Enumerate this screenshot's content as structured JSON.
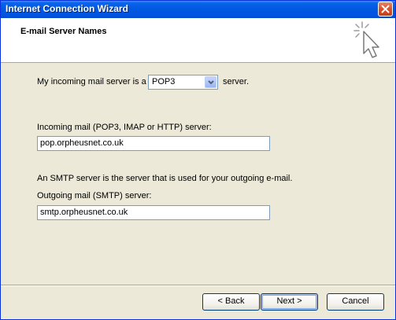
{
  "window": {
    "title": "Internet Connection Wizard"
  },
  "header": {
    "title": "E-mail Server Names"
  },
  "form": {
    "incoming_type_prefix": "My incoming mail server is a",
    "incoming_type_value": "POP3",
    "incoming_type_suffix": "server.",
    "incoming_label": "Incoming mail (POP3, IMAP or HTTP) server:",
    "incoming_value": "pop.orpheusnet.co.uk",
    "smtp_info": "An SMTP server is the server that is used for your outgoing e-mail.",
    "outgoing_label": "Outgoing mail (SMTP) server:",
    "outgoing_value": "smtp.orpheusnet.co.uk"
  },
  "buttons": {
    "back": "< Back",
    "next": "Next >",
    "cancel": "Cancel"
  },
  "icons": {
    "close": "close-icon",
    "wizard": "wizard-cursor-icon",
    "dropdown": "chevron-down-icon"
  },
  "colors": {
    "titlebar": "#0054e3",
    "dialog_bg": "#ece9d8",
    "header_bg": "#ffffff"
  }
}
